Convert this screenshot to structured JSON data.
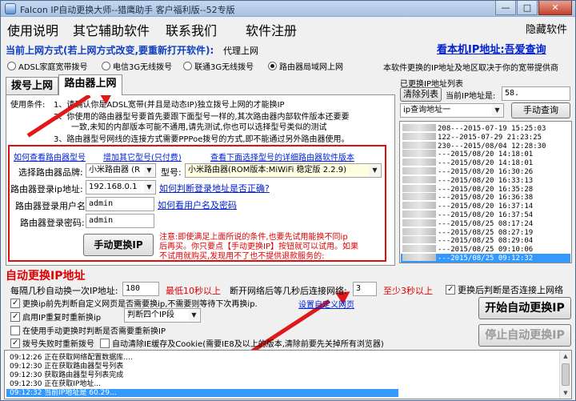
{
  "window": {
    "title": "Falcon IP自动更换大师--猎鹰助手 客户福利版--52专版",
    "minimize": "—",
    "maximize": "□",
    "close": "✕"
  },
  "menu": {
    "items": [
      "使用说明",
      "其它辅助软件",
      "联系我们",
      "软件注册"
    ],
    "hide": "隐藏软件"
  },
  "mode": {
    "label": "当前上网方式(若上网方式改变,要重新打开软件):",
    "value": "代理上网",
    "radios": [
      "ADSL家庭宽带拨号",
      "电信3G无线拨号",
      "联通3G无线拨号",
      "路由器局域网上网"
    ],
    "selected_index": 3
  },
  "ip_check": {
    "link": "看本机IP地址:吾爱查询",
    "region_note": "本软件更换的IP地址及地区取决于你的宽带提供商"
  },
  "tabs": [
    "拨号上网",
    "路由器上网"
  ],
  "router": {
    "conditions_prefix": "使用条件:",
    "conditions": [
      "1、请确认你是ADSL宽带(并且是动态IP)独立拨号上网的才能换IP",
      "2、你使用的路由器型号要首先要跟下面型号一样的,其次路由器内部软件版本还要要",
      "一致,未知的内部版本可能不通用,请先测试,你也可以选择型号类似的测试",
      "3、路由器型号网线的连接方式需要PPPoe拨号的方式,即不能通过另外路由器使用。"
    ],
    "link_view_models": "如何查看路由器型号",
    "link_add_models": "增加其它型号(只付费)",
    "link_firmware": "查看下面选择型号的详细路由器软件版本",
    "brand_label": "选择路由器品牌:",
    "brand_value": "小米路由器 (R",
    "model_label": "型号:",
    "model_value": "小米路由器(ROM版本:MiWiFi 稳定版 2.2.9)",
    "login_ip_label": "路由器登录ip地址:",
    "login_ip_value": "192.168.0.1",
    "link_check_login": "如何判断登录地址是否正确?",
    "user_label": "路由器登录用户名:",
    "user_value": "admin",
    "link_view_user": "如何看用户名及密码",
    "pass_label": "路由器登录密码:",
    "pass_value": "admin",
    "manual_button": "手动更换IP",
    "warning": [
      "注意:即使满足上面所说的条件,也要先试用能换不同ip",
      "后再买。你只要点【手动更换IP】按钮就可以试用。如果",
      "不试用就购买,发现用不了也不提供退款服务的:"
    ]
  },
  "ip_panel": {
    "title": "已更换IP地址列表",
    "clear_button": "清除列表",
    "current_label": "当前IP地址是:",
    "current_ip_value": "58.",
    "query_select": "ip查询地址一",
    "query_button": "手动查询",
    "entries": [
      {
        "ip": "208",
        "time": "---2015-07-19 15:25:03"
      },
      {
        "ip": "122",
        "time": "--2015-07-29 21:23:25"
      },
      {
        "ip": "230",
        "time": "---2015/08/04 12:28:30"
      },
      {
        "ip": "",
        "time": "---2015/08/20 14:18:01"
      },
      {
        "ip": "",
        "time": "---2015/08/20 14:18:01"
      },
      {
        "ip": "",
        "time": "---2015/08/20 16:30:26"
      },
      {
        "ip": "",
        "time": "---2015/08/20 16:33:13"
      },
      {
        "ip": "",
        "time": "---2015/08/20 16:35:28"
      },
      {
        "ip": "",
        "time": "---2015/08/20 16:36:38"
      },
      {
        "ip": "",
        "time": "---2015/08/20 16:37:14"
      },
      {
        "ip": "",
        "time": "---2015/08/20 16:37:54"
      },
      {
        "ip": "",
        "time": "---2015/08/25 08:17:24"
      },
      {
        "ip": "",
        "time": "---2015/08/25 08:27:19"
      },
      {
        "ip": "",
        "time": "---2015/08/25 08:29:04"
      },
      {
        "ip": "",
        "time": "---2015/08/25 09:10:06"
      },
      {
        "ip": "",
        "time": "---2015/08/25 09:12:32"
      }
    ],
    "selected_index": 15
  },
  "auto": {
    "title": "自动更换IP地址",
    "interval_label": "每隔几秒自动换一次IP地址:",
    "interval_value": "180",
    "interval_note": "最低10秒以上",
    "reconnect_label": "断开网络后等几秒后连接网络:",
    "reconnect_value": "3",
    "reconnect_note": "至少3秒以上",
    "check_connected": "更换后判断是否连接上网络",
    "opt1": "更换ip前先判断自定义网页是否需要换ip,不需要则等待下次再换ip.",
    "opt1_link": "设置自定义网页",
    "opt2": "启用IP重复时重新换ip",
    "opt2_select": "判断四个IP段",
    "opt3": "在使用手动更换时判断是否需要重新换IP",
    "opt4": "拨号失败时重新拨号",
    "opt5": "自动清除IE缓存及Cookie(需要IE8及以上的版本,清除前要先关掉所有浏览器)",
    "start_button": "开始自动更换IP",
    "stop_button": "停止自动更换IP"
  },
  "log": [
    "09:12:26 正在获取网络配置数据库....",
    "09:12:30 正在获取路由器型号列表",
    "09:12:30 获取路由器型号列表完成",
    "09:12:30 正在获取IP地址...",
    "09:12:32 当前IP地址是 60.29..."
  ]
}
